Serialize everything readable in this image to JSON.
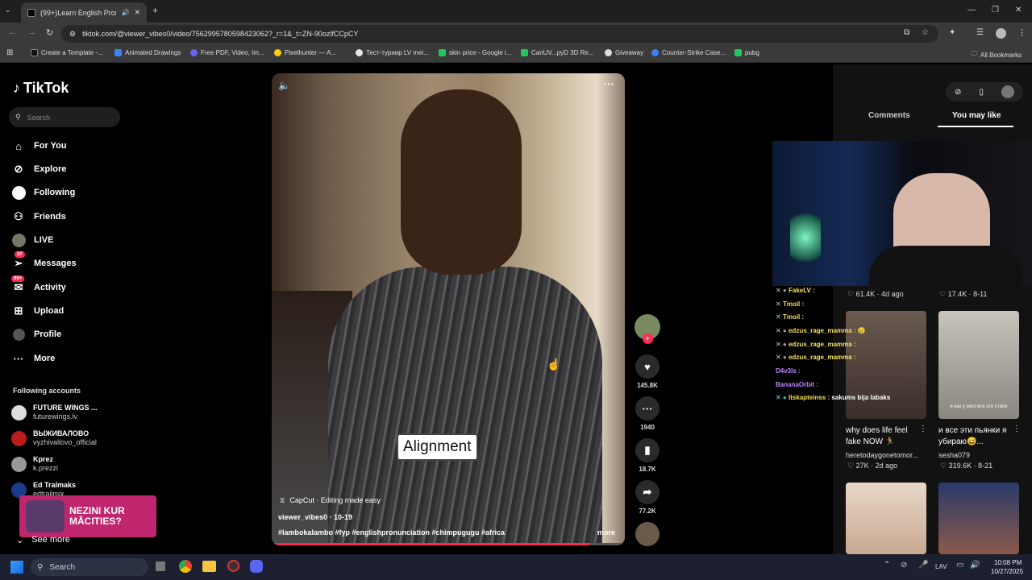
{
  "browser": {
    "tab_title": "(99+)Learn English Pronunc",
    "url": "tiktok.com/@viewer_vibes0/video/7562995780598423062?_r=1&_t=ZN-90ozlfCCpCY",
    "bookmarks": [
      "Create a Template -...",
      "Animated Drawings",
      "Free PDF, Video, Im...",
      "Pixelhunter — A...",
      "Тест-турнир LV mei...",
      "skin price - Google i...",
      "CanUV...pyD 3D Re...",
      "Giveaway",
      "Counter-Strike Case...",
      "pubg"
    ],
    "all_bookmarks": "All Bookmarks"
  },
  "sidebar": {
    "logo": "TikTok",
    "search_placeholder": "Search",
    "nav": [
      {
        "label": "For You"
      },
      {
        "label": "Explore"
      },
      {
        "label": "Following"
      },
      {
        "label": "Friends"
      },
      {
        "label": "LIVE"
      },
      {
        "label": "Messages",
        "badge": "37"
      },
      {
        "label": "Activity",
        "badge": "99+"
      },
      {
        "label": "Upload"
      },
      {
        "label": "Profile"
      },
      {
        "label": "More"
      }
    ],
    "following_title": "Following accounts",
    "accounts": [
      {
        "name": "FUTURE WINGS ...",
        "handle": "futurewings.lv"
      },
      {
        "name": "ВЫЖИВАЛОВО",
        "handle": "vyzhivallovo_official"
      },
      {
        "name": "Kprez",
        "handle": "k.prezzi"
      },
      {
        "name": "Ed Tralmaks",
        "handle": "edtrailmix"
      }
    ],
    "see_more": "See more",
    "promo": "NEZINI KUR MĀCITIES?"
  },
  "video": {
    "caption_overlay": "Alignment",
    "capcut": "CapCut · Editing made easy",
    "author_line": "viewer_vibes0 · 10-19",
    "hashtags": "#lambokalambo #fyp #englishpronunciation #chimpugugu #africa",
    "more": "more",
    "progress": 0.9
  },
  "actions": {
    "likes": "145.8K",
    "comments": "1940",
    "saves": "18.7K",
    "shares": "77.2K"
  },
  "right_panel": {
    "tabs": [
      "Comments",
      "You may like"
    ],
    "row1": [
      {
        "likes": "61.4K",
        "date": "4d ago"
      },
      {
        "likes": "17.4K",
        "date": "8-11"
      }
    ],
    "row2": [
      {
        "title": "why does life feel fake NOW 🏃",
        "author": "heretodaygonetomor...",
        "likes": "27K",
        "date": "2d ago"
      },
      {
        "title": "и все эти пьянки я убираю😅...",
        "author": "sesha079",
        "likes": "319.6K",
        "date": "8-21",
        "thumb_text": "и как у него все это строе"
      }
    ]
  },
  "chat": [
    {
      "user": "FakeLV :",
      "msg": "",
      "color": "#f6e05e"
    },
    {
      "user": "Tmoil :",
      "msg": "",
      "color": "#f6e05e"
    },
    {
      "user": "Tmoil :",
      "msg": "",
      "color": "#f6e05e"
    },
    {
      "user": "edzus_rage_mamma :",
      "msg": "😢",
      "color": "#f6e05e"
    },
    {
      "user": "edzus_rage_mamma :",
      "msg": "",
      "color": "#f6e05e"
    },
    {
      "user": "edzus_rage_mamma :",
      "msg": "",
      "color": "#f6e05e"
    },
    {
      "user": "D4v3ls :",
      "msg": "",
      "color": "#c084fc"
    },
    {
      "user": "BananaOrbit :",
      "msg": "",
      "color": "#c084fc"
    },
    {
      "user": "Itskapteinss :",
      "msg": "sakums bija labaks",
      "color": "#f6e05e"
    }
  ],
  "taskbar": {
    "search_placeholder": "Search",
    "lang": "LAV",
    "time": "10:08 PM",
    "date": "10/27/2025"
  }
}
